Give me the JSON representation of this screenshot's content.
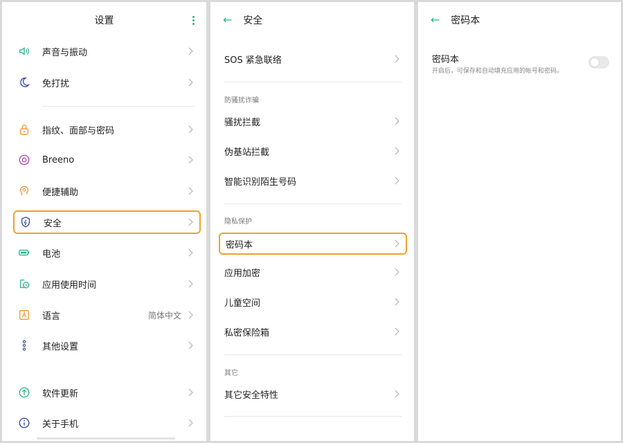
{
  "colors": {
    "accent": "#2bb58a",
    "highlight": "#f0a030"
  },
  "settings_panel": {
    "title": "设置",
    "items": [
      {
        "label": "声音与振动",
        "icon": "speaker-icon"
      },
      {
        "label": "免打扰",
        "icon": "moon-icon"
      },
      {
        "label": "指纹、面部与密码",
        "icon": "lock-icon"
      },
      {
        "label": "Breeno",
        "icon": "breeno-icon"
      },
      {
        "label": "便捷辅助",
        "icon": "assist-icon"
      },
      {
        "label": "安全",
        "icon": "shield-icon",
        "highlighted": true
      },
      {
        "label": "电池",
        "icon": "battery-icon"
      },
      {
        "label": "应用使用时间",
        "icon": "screen-time-icon"
      },
      {
        "label": "语言",
        "icon": "language-icon",
        "value": "简体中文"
      },
      {
        "label": "其他设置",
        "icon": "more-settings-icon"
      },
      {
        "label": "软件更新",
        "icon": "update-icon"
      },
      {
        "label": "关于手机",
        "icon": "info-icon"
      }
    ]
  },
  "security_panel": {
    "title": "安全",
    "items": [
      {
        "label": "SOS 紧急联络"
      },
      {
        "label": "骚扰拦截"
      },
      {
        "label": "伪基站拦截"
      },
      {
        "label": "智能识别陌生号码"
      },
      {
        "label": "密码本",
        "highlighted": true
      },
      {
        "label": "应用加密"
      },
      {
        "label": "儿童空间"
      },
      {
        "label": "私密保险箱"
      },
      {
        "label": "其它安全特性"
      }
    ],
    "sections": [
      "防骚扰诈骗",
      "隐私保护",
      "其它"
    ]
  },
  "password_panel": {
    "title": "密码本",
    "setting_title": "密码本",
    "setting_desc": "开启后，可保存和自动填充应用的帐号和密码。",
    "toggle_on": false
  }
}
